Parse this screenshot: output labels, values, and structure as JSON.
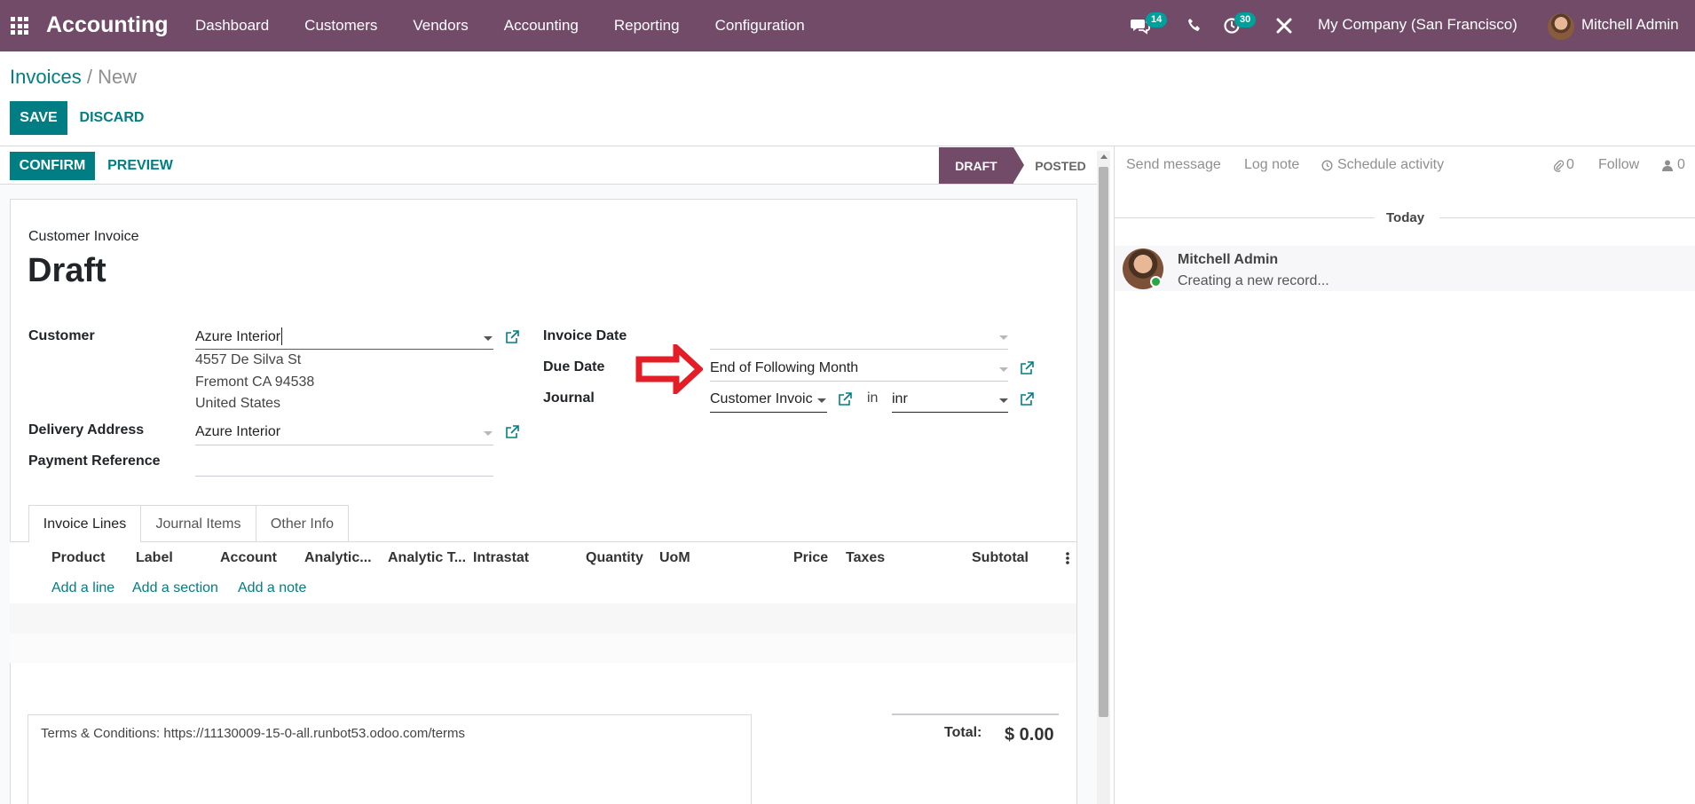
{
  "navbar": {
    "brand": "Accounting",
    "menu": [
      "Dashboard",
      "Customers",
      "Vendors",
      "Accounting",
      "Reporting",
      "Configuration"
    ],
    "messages_badge": "14",
    "activities_badge": "30",
    "company": "My Company (San Francisco)",
    "user": "Mitchell Admin"
  },
  "breadcrumb": {
    "parent": "Invoices",
    "separator": " / ",
    "current": "New"
  },
  "buttons": {
    "save": "SAVE",
    "discard": "DISCARD",
    "confirm": "CONFIRM",
    "preview": "PREVIEW"
  },
  "status": {
    "draft": "DRAFT",
    "posted": "POSTED"
  },
  "form": {
    "type_label": "Customer Invoice",
    "title": "Draft",
    "customer_label": "Customer",
    "customer_value": "Azure Interior",
    "address": [
      "4557 De Silva St",
      "Fremont CA 94538",
      "United States"
    ],
    "delivery_label": "Delivery Address",
    "delivery_value": "Azure Interior",
    "payment_ref_label": "Payment Reference",
    "invoice_date_label": "Invoice Date",
    "due_date_label": "Due Date",
    "due_date_value": "End of Following Month",
    "journal_label": "Journal",
    "journal_value": "Customer Invoic",
    "journal_in": "in",
    "currency_value": "inr"
  },
  "tabs": [
    "Invoice Lines",
    "Journal Items",
    "Other Info"
  ],
  "columns": [
    "Product",
    "Label",
    "Account",
    "Analytic...",
    "Analytic T...",
    "Intrastat",
    "Quantity",
    "UoM",
    "Price",
    "Taxes",
    "Subtotal"
  ],
  "add_links": [
    "Add a line",
    "Add a section",
    "Add a note"
  ],
  "terms": "Terms & Conditions: https://11130009-15-0-all.runbot53.odoo.com/terms",
  "total": {
    "label": "Total:",
    "value": "$ 0.00"
  },
  "chatter": {
    "send_message": "Send message",
    "log_note": "Log note",
    "schedule_activity": "Schedule activity",
    "attachments_count": "0",
    "follow": "Follow",
    "followers_count": "0",
    "today": "Today",
    "message_author": "Mitchell Admin",
    "message_body": "Creating a new record..."
  },
  "colors": {
    "brand": "#714b67",
    "accent": "#017e84",
    "arrow": "#e41e26"
  }
}
